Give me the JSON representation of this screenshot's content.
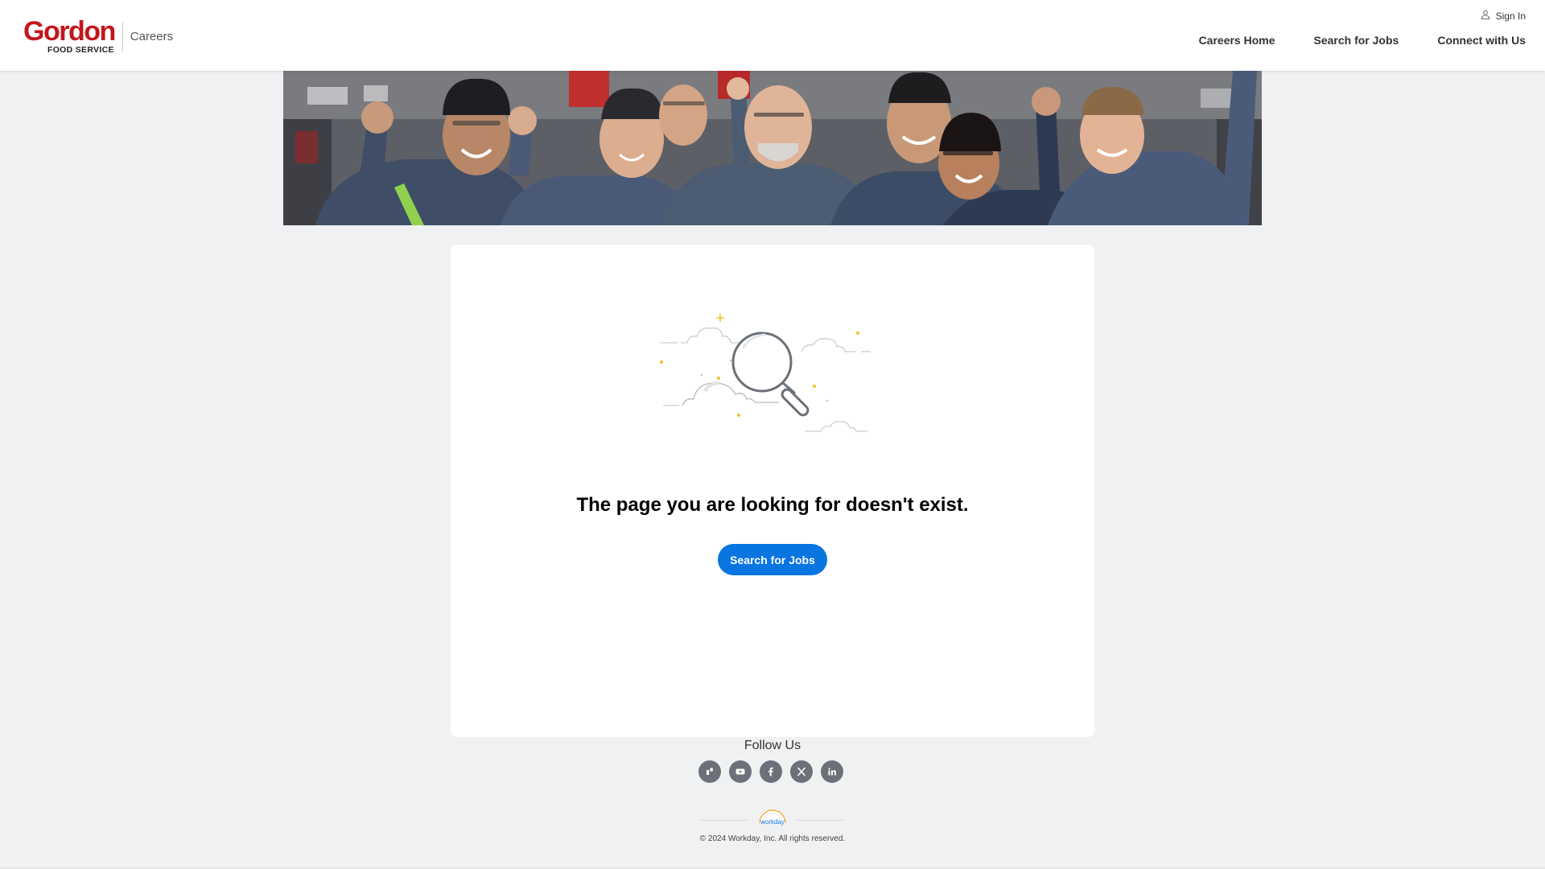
{
  "brand": {
    "name": "Gordon",
    "subtitle": "FOOD SERVICE",
    "section": "Careers",
    "color": "#c4161c"
  },
  "header": {
    "signin_label": "Sign In",
    "nav": [
      {
        "label": "Careers Home"
      },
      {
        "label": "Search for Jobs"
      },
      {
        "label": "Connect with Us"
      }
    ]
  },
  "error": {
    "message": "The page you are looking for doesn't exist.",
    "button_label": "Search for Jobs",
    "button_color": "#0875e1"
  },
  "footer": {
    "follow_label": "Follow Us",
    "social": [
      {
        "icon": "glassdoor-icon"
      },
      {
        "icon": "youtube-icon"
      },
      {
        "icon": "facebook-icon"
      },
      {
        "icon": "x-icon"
      },
      {
        "icon": "linkedin-icon"
      }
    ],
    "workday_label": "workday",
    "copyright": "© 2024 Workday, Inc. All rights reserved."
  }
}
